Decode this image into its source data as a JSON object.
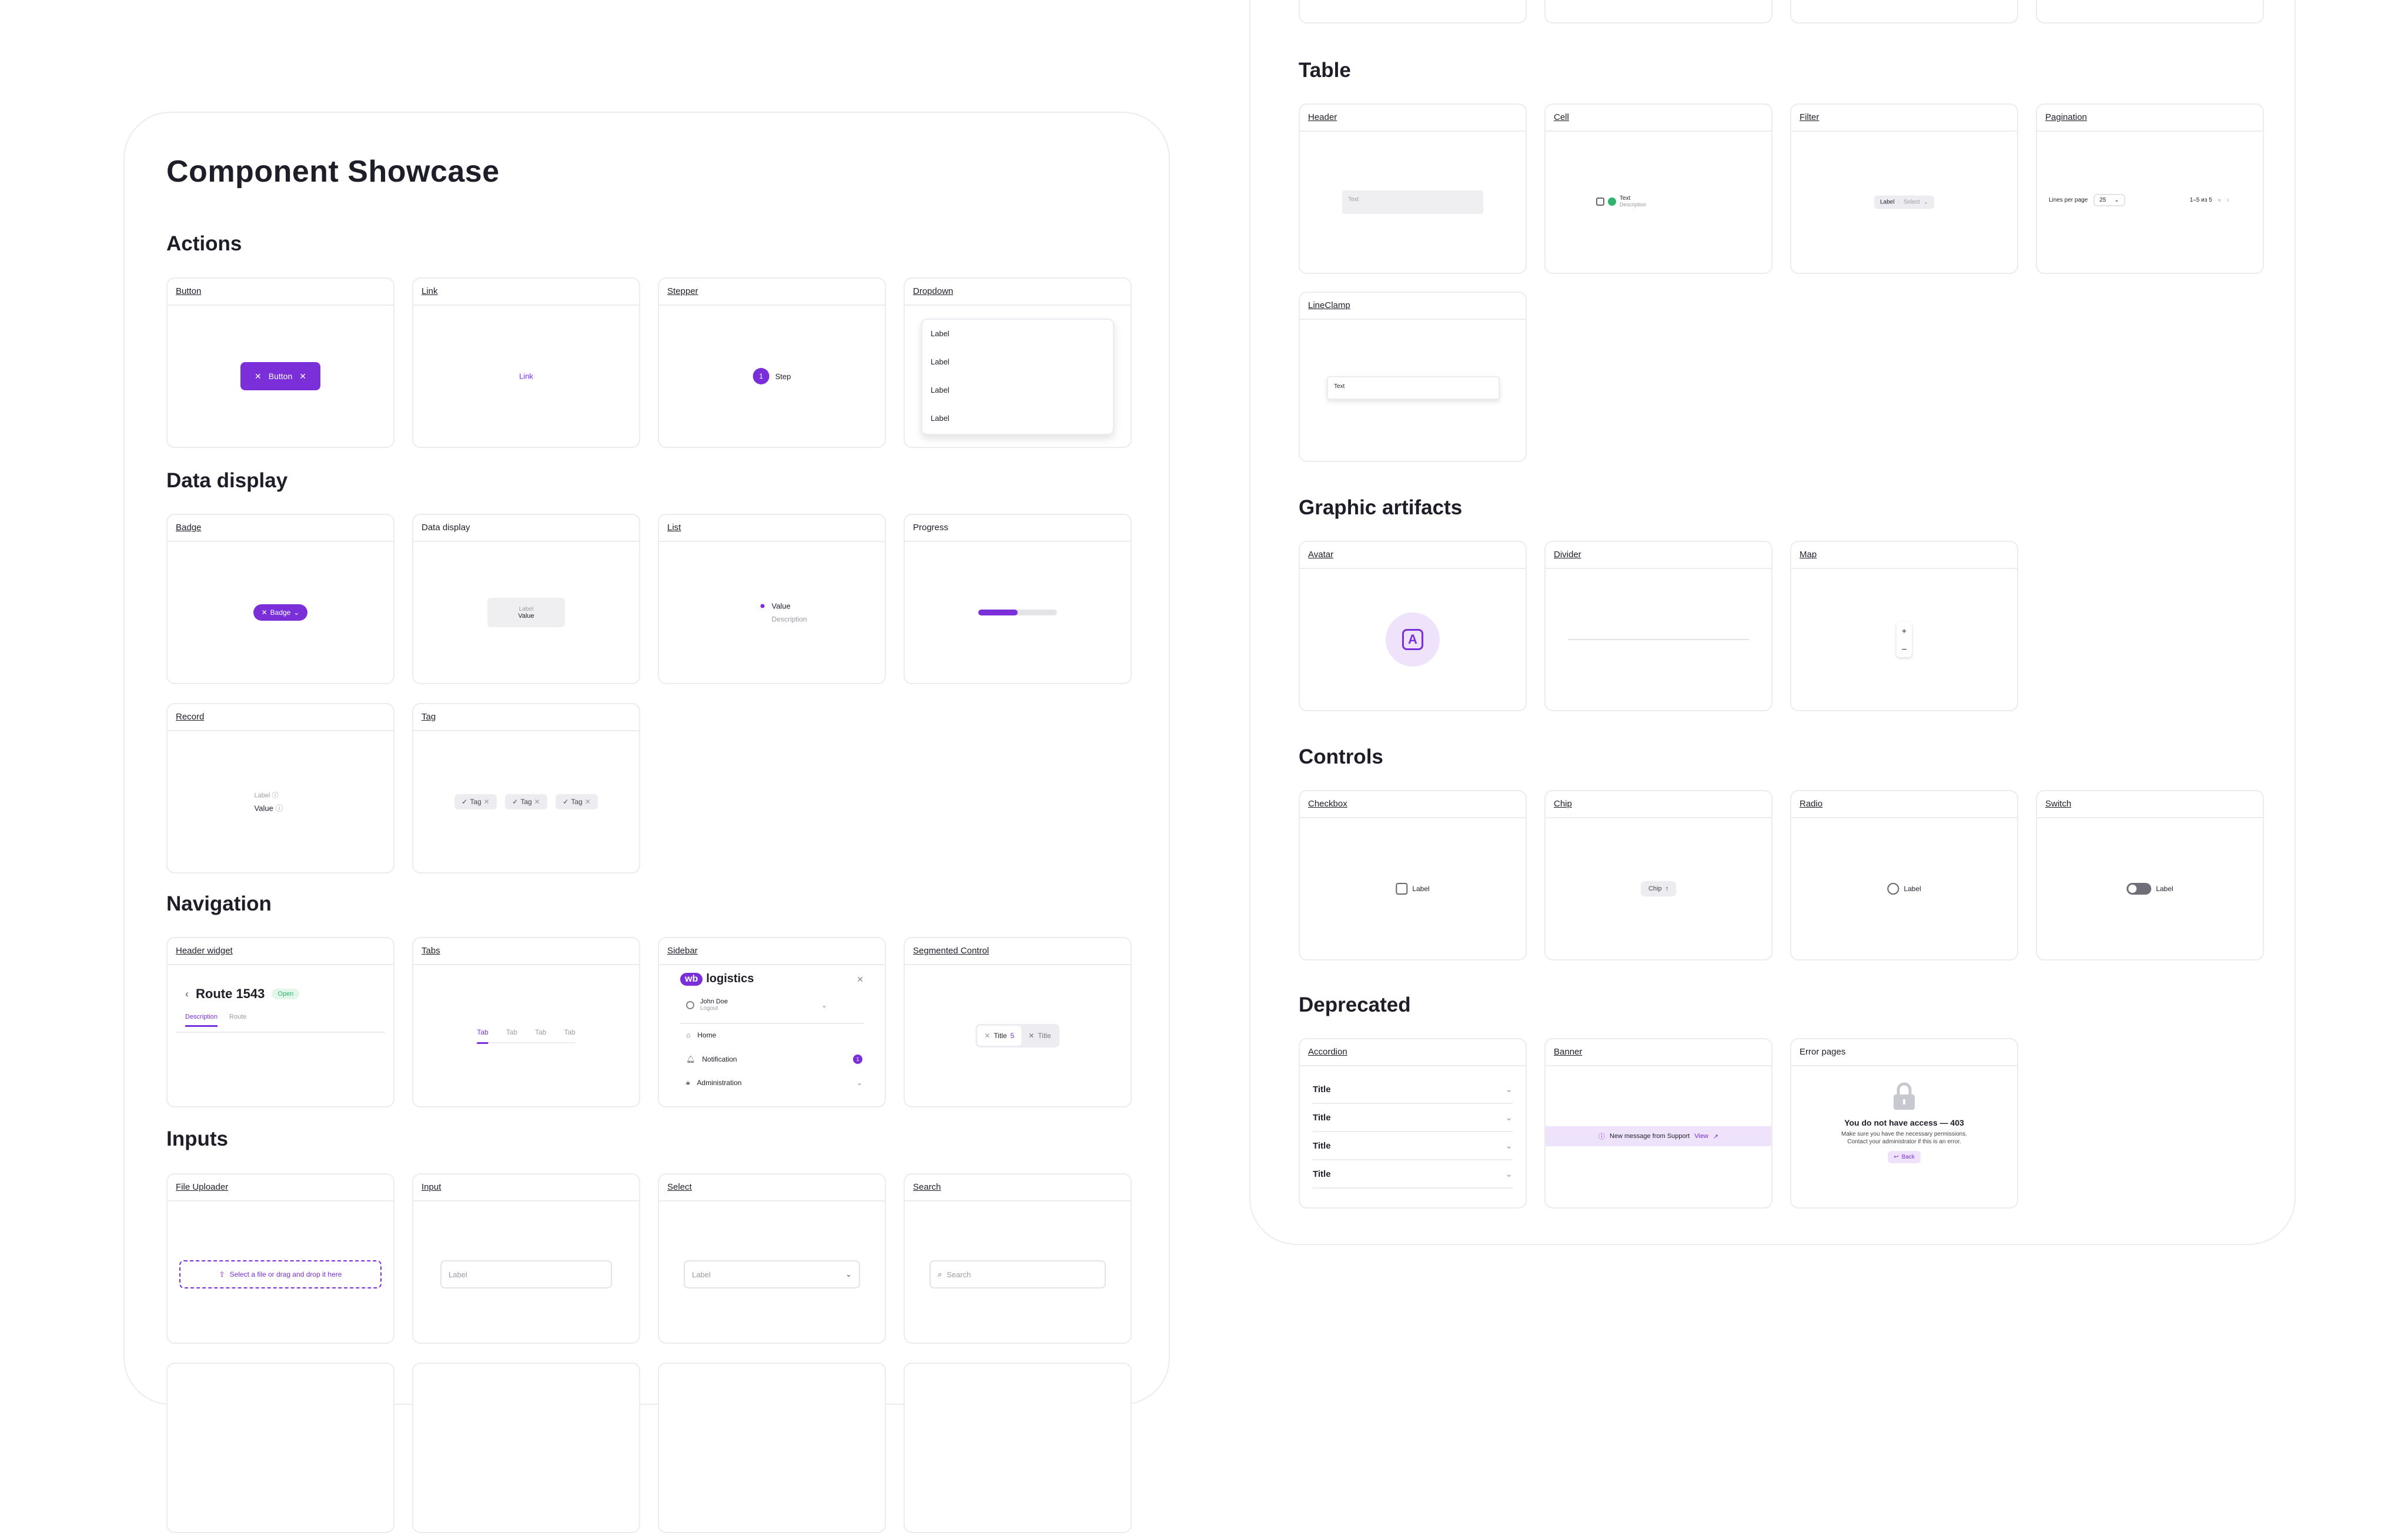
{
  "page_title": "Component Showcase",
  "colors": {
    "accent": "#7a2fd8",
    "accent_light": "#efe3fb",
    "border": "#ececf0",
    "success": "#2fb36d"
  },
  "sections": {
    "actions": "Actions",
    "data_display": "Data display",
    "navigation": "Navigation",
    "inputs": "Inputs",
    "table": "Table",
    "graphic_artifacts": "Graphic artifacts",
    "controls": "Controls",
    "deprecated": "Deprecated"
  },
  "cards": {
    "button": {
      "label": "Button",
      "button_text": "Button"
    },
    "link": {
      "label": "Link",
      "link_text": "Link"
    },
    "stepper": {
      "label": "Stepper",
      "step_number": "1",
      "step_text": "Step"
    },
    "dropdown": {
      "label": "Dropdown",
      "items": [
        "Label",
        "Label",
        "Label",
        "Label"
      ]
    },
    "badge": {
      "label": "Badge",
      "badge_text": "Badge"
    },
    "data_display": {
      "label": "Data display",
      "dd_label": "Label",
      "dd_value": "Value"
    },
    "list": {
      "label": "List",
      "value": "Value",
      "description": "Description"
    },
    "progress": {
      "label": "Progress",
      "value": 0.5
    },
    "record": {
      "label": "Record",
      "rec_label": "Label",
      "rec_value": "Value"
    },
    "tag": {
      "label": "Tag",
      "tags": [
        "Tag",
        "Tag",
        "Tag"
      ]
    },
    "header_widget": {
      "label": "Header widget",
      "title": "Route 1543",
      "status": "Open",
      "tab_active": "Description",
      "tab_other": "Route"
    },
    "tabs": {
      "label": "Tabs",
      "tabs": [
        "Tab",
        "Tab",
        "Tab",
        "Tab"
      ]
    },
    "sidebar": {
      "label": "Sidebar",
      "logo_mark": "wb",
      "logo_text": "logistics",
      "user_name": "John Doe",
      "user_action": "Logout",
      "items": [
        "Home",
        "Notification",
        "Administration"
      ],
      "notification_count": "1"
    },
    "segmented": {
      "label": "Segmented Control",
      "options": [
        "Title",
        "Title"
      ],
      "count": "5"
    },
    "file_uploader": {
      "label": "File Uploader",
      "text": "Select a file or drag and drop it here"
    },
    "input": {
      "label": "Input",
      "placeholder": "Label"
    },
    "select": {
      "label": "Select",
      "placeholder": "Label"
    },
    "search": {
      "label": "Search",
      "placeholder": "Search"
    },
    "t_header": {
      "label": "Header",
      "text": "Text"
    },
    "t_cell": {
      "label": "Cell",
      "text": "Text",
      "description": "Description"
    },
    "t_filter": {
      "label": "Filter",
      "filter_label": "Label",
      "filter_value": "Select"
    },
    "t_pagination": {
      "label": "Pagination",
      "lines_label": "Lines per page",
      "lines_value": "25",
      "range": "1–5 из 5"
    },
    "t_lineclamp": {
      "label": "LineClamp",
      "text": "Text"
    },
    "avatar": {
      "label": "Avatar",
      "letter": "A"
    },
    "divider": {
      "label": "Divider"
    },
    "map": {
      "label": "Map",
      "zoom_in": "+",
      "zoom_out": "–"
    },
    "checkbox": {
      "label": "Checkbox",
      "text": "Label"
    },
    "chip": {
      "label": "Chip",
      "text": "Chip"
    },
    "radio": {
      "label": "Radio",
      "text": "Label"
    },
    "switch": {
      "label": "Switch",
      "text": "Label"
    },
    "accordion": {
      "label": "Accordion",
      "items": [
        "Title",
        "Title",
        "Title",
        "Title"
      ]
    },
    "banner": {
      "label": "Banner",
      "text": "New message from Support",
      "link": "View"
    },
    "error_pages": {
      "label": "Error pages",
      "title": "You do not have access — 403",
      "line1": "Make sure you have the necessary permissions.",
      "line2": "Contact your administrator if this is an error.",
      "back": "Back"
    }
  }
}
